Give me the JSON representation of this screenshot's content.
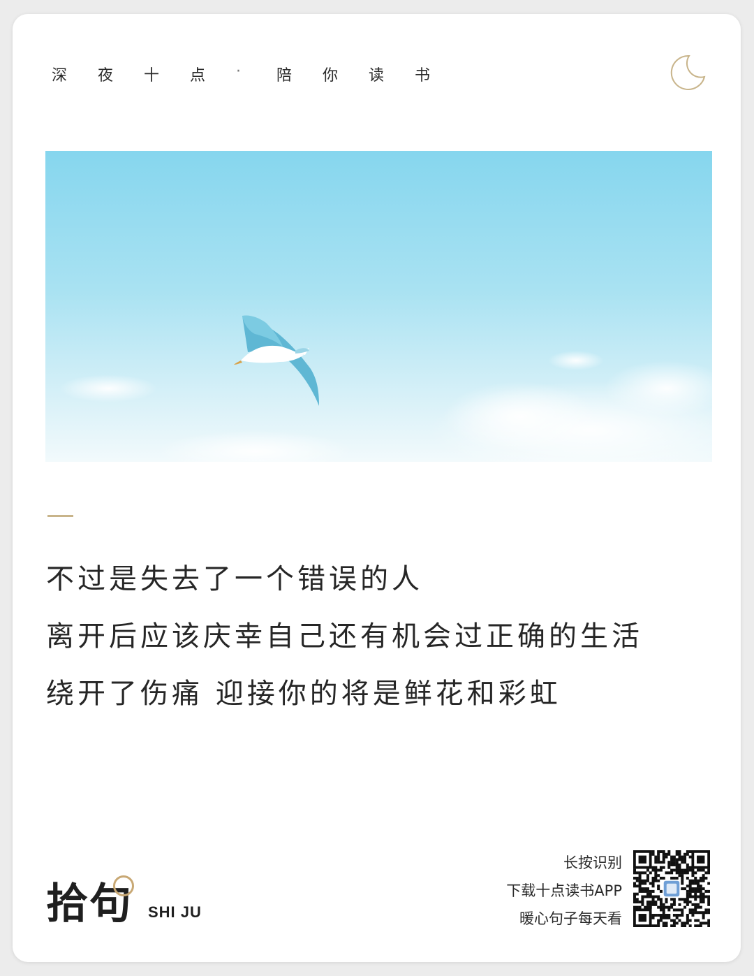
{
  "header": {
    "chars": [
      "深",
      "夜",
      "十",
      "点",
      "·",
      "陪",
      "你",
      "读",
      "书"
    ]
  },
  "icons": {
    "moon": "crescent-moon-icon",
    "qr": "qr-code-icon"
  },
  "colors": {
    "accent": "#c8b48a",
    "text": "#262626",
    "sky_top": "#8fd8ee",
    "sky_bottom": "#e4f5fa"
  },
  "quote": {
    "lines": [
      "不过是失去了一个错误的人",
      "离开后应该庆幸自己还有机会过正确的生活",
      "绕开了伤痛 迎接你的将是鲜花和彩虹"
    ]
  },
  "logo": {
    "cn": "拾句",
    "en": "SHI JU"
  },
  "cta": {
    "line1": "长按识别",
    "line2": "下载十点读书APP",
    "line3": "暖心句子每天看"
  }
}
